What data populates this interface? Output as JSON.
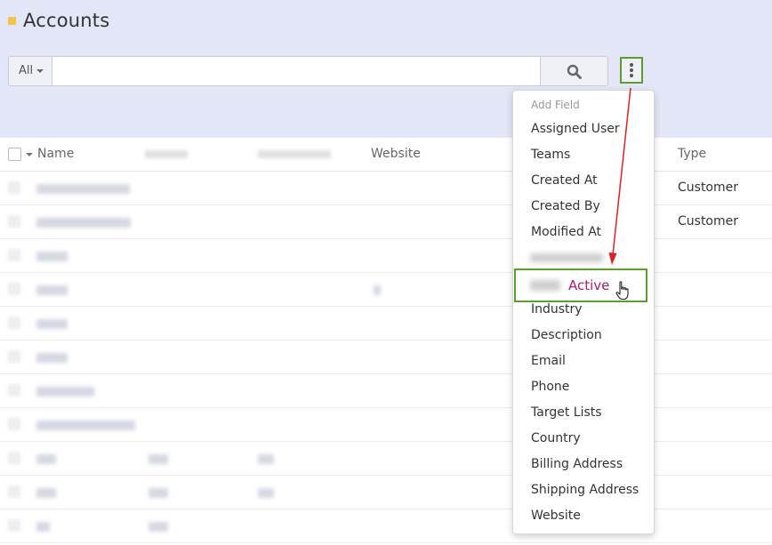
{
  "header": {
    "title": "Accounts"
  },
  "search": {
    "scope_label": "All",
    "query": "",
    "placeholder": ""
  },
  "table": {
    "columns": {
      "name": "Name",
      "website": "Website",
      "type": "Type"
    },
    "rows": [
      {
        "type": "Customer"
      },
      {
        "type": "Customer"
      },
      {
        "type": ""
      },
      {
        "type": ""
      },
      {
        "type": ""
      },
      {
        "type": ""
      },
      {
        "type": ""
      },
      {
        "type": ""
      },
      {
        "type": ""
      },
      {
        "type": ""
      },
      {
        "type": ""
      }
    ]
  },
  "menu": {
    "header": "Add Field",
    "items": [
      "Assigned User",
      "Teams",
      "Created At",
      "Created By",
      "Modified At",
      "Industry",
      "Description",
      "Email",
      "Phone",
      "Target Lists",
      "Country",
      "Billing Address",
      "Shipping Address",
      "Website"
    ],
    "highlighted": "Active"
  },
  "colors": {
    "header_bg": "#e3e6f7",
    "highlight_border": "#5b9e2e",
    "highlight_text": "#b0176e",
    "annotation_arrow": "#e02020",
    "title_marker": "#f3c34c"
  },
  "icons": {
    "search": "search-icon",
    "kebab": "kebab-menu-icon",
    "cursor": "hand-cursor-icon",
    "arrow": "annotation-arrow-icon"
  }
}
